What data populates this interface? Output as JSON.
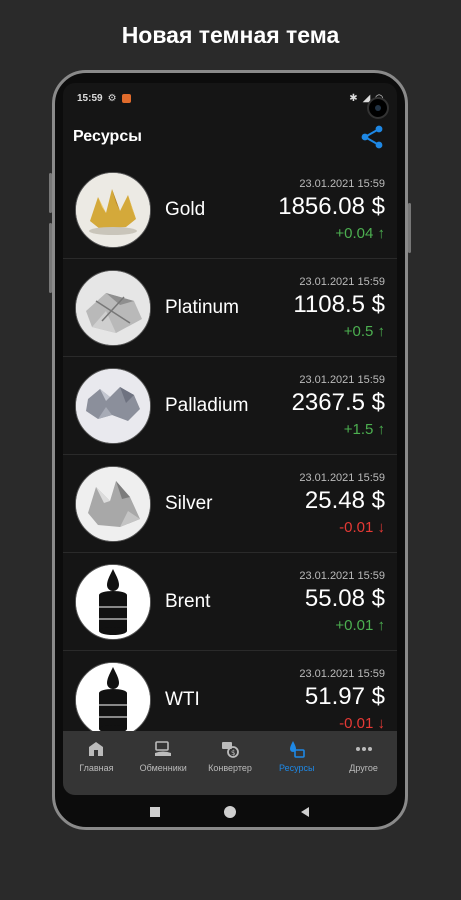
{
  "promo": {
    "title": "Новая темная тема"
  },
  "status_bar": {
    "time": "15:59"
  },
  "header": {
    "title": "Ресурсы",
    "share_icon": "share-icon"
  },
  "resources": [
    {
      "name": "Gold",
      "date": "23.01.2021 15:59",
      "price": "1856.08 $",
      "change": "+0.04 ↑",
      "direction": "up"
    },
    {
      "name": "Platinum",
      "date": "23.01.2021 15:59",
      "price": "1108.5 $",
      "change": "+0.5 ↑",
      "direction": "up"
    },
    {
      "name": "Palladium",
      "date": "23.01.2021 15:59",
      "price": "2367.5 $",
      "change": "+1.5 ↑",
      "direction": "up"
    },
    {
      "name": "Silver",
      "date": "23.01.2021 15:59",
      "price": "25.48 $",
      "change": "-0.01 ↓",
      "direction": "down"
    },
    {
      "name": "Brent",
      "date": "23.01.2021 15:59",
      "price": "55.08 $",
      "change": "+0.01 ↑",
      "direction": "up"
    },
    {
      "name": "WTI",
      "date": "23.01.2021 15:59",
      "price": "51.97 $",
      "change": "-0.01 ↓",
      "direction": "down"
    }
  ],
  "bottom_nav": [
    {
      "label": "Главная",
      "icon": "home-icon",
      "active": false
    },
    {
      "label": "Обменники",
      "icon": "exchange-icon",
      "active": false
    },
    {
      "label": "Конвертер",
      "icon": "converter-icon",
      "active": false
    },
    {
      "label": "Ресурсы",
      "icon": "resources-icon",
      "active": true
    },
    {
      "label": "Другое",
      "icon": "more-icon",
      "active": false
    }
  ],
  "colors": {
    "accent": "#1e88e5",
    "up": "#4caf50",
    "down": "#e53935",
    "background": "#151515"
  }
}
